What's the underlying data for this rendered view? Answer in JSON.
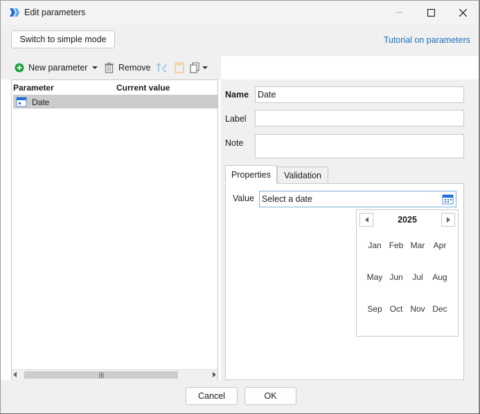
{
  "window": {
    "title": "Edit parameters",
    "minimize_icon": "minimize-icon",
    "maximize_icon": "maximize-icon",
    "close_icon": "close-icon"
  },
  "topbar": {
    "simple_mode_label": "Switch to simple mode",
    "tutorial_link": "Tutorial on parameters"
  },
  "toolbar": {
    "new_parameter_label": "New parameter",
    "remove_label": "Remove"
  },
  "param_list": {
    "headers": [
      "Parameter",
      "Current value"
    ],
    "rows": [
      {
        "name": "Date",
        "value": "",
        "icon": "calendar-icon",
        "selected": true
      }
    ]
  },
  "form": {
    "name_label": "Name",
    "name_value": "Date",
    "label_label": "Label",
    "label_value": "",
    "note_label": "Note",
    "note_value": ""
  },
  "tabs": [
    "Properties",
    "Validation"
  ],
  "properties": {
    "value_label": "Value",
    "date_placeholder": "Select a date"
  },
  "calendar": {
    "year": "2025",
    "months": [
      "Jan",
      "Feb",
      "Mar",
      "Apr",
      "May",
      "Jun",
      "Jul",
      "Aug",
      "Sep",
      "Oct",
      "Nov",
      "Dec"
    ]
  },
  "footer": {
    "cancel_label": "Cancel",
    "ok_label": "OK"
  },
  "colors": {
    "link": "#1f6fbf",
    "selection": "#cccccc",
    "accent_icon": "#1e6fd9",
    "add_icon": "#1e9e3a"
  }
}
